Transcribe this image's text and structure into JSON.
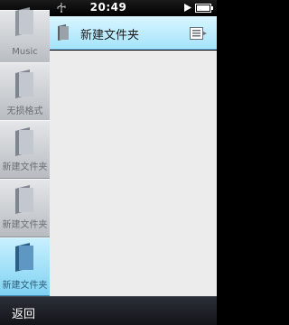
{
  "status_bar": {
    "time": "20:49",
    "left_icon": "usb-icon",
    "play_icon": "play-icon",
    "battery_icon": "battery-icon"
  },
  "sidebar": {
    "items": [
      {
        "label": "Music",
        "icon": "folder-icon",
        "active": false
      },
      {
        "label": "无损格式",
        "icon": "folder-icon",
        "active": false
      },
      {
        "label": "新建文件夹",
        "icon": "folder-icon",
        "active": false
      },
      {
        "label": "新建文件夹",
        "icon": "folder-icon",
        "active": false
      },
      {
        "label": "新建文件夹",
        "icon": "folder-icon",
        "active": true
      }
    ]
  },
  "header": {
    "title": "新建文件夹",
    "icon": "folder-icon",
    "menu_icon": "list-menu-icon"
  },
  "bottom_bar": {
    "back_label": "返回"
  },
  "colors": {
    "accent": "#a5e3fa",
    "content_bg": "#ececec",
    "sidebar_bg": "#c9ccd0"
  }
}
